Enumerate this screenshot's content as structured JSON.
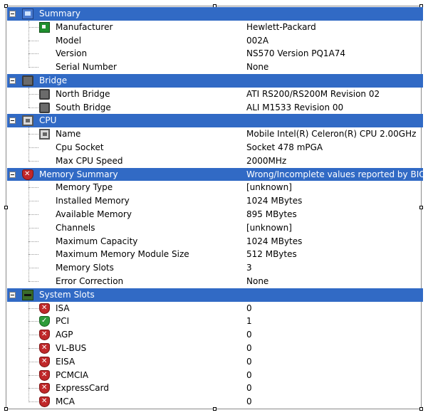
{
  "sections": [
    {
      "label": "Summary",
      "icon": "computer-icon",
      "value": "",
      "items": [
        {
          "label": "Manufacturer",
          "value": "Hewlett-Packard",
          "icon": "board-icon"
        },
        {
          "label": "Model",
          "value": "002A",
          "icon": ""
        },
        {
          "label": "Version",
          "value": "NS570 Version PQ1A74",
          "icon": ""
        },
        {
          "label": "Serial Number",
          "value": "None",
          "icon": ""
        }
      ]
    },
    {
      "label": "Bridge",
      "icon": "chip-icon",
      "value": "",
      "items": [
        {
          "label": "North Bridge",
          "value": "ATI RS200/RS200M Revision 02",
          "icon": "chip-icon"
        },
        {
          "label": "South Bridge",
          "value": "ALI M1533 Revision 00",
          "icon": "chip-icon"
        }
      ]
    },
    {
      "label": "CPU",
      "icon": "cpu-icon",
      "value": "",
      "items": [
        {
          "label": "Name",
          "value": "Mobile Intel(R) Celeron(R) CPU 2.00GHz",
          "icon": "cpu-icon"
        },
        {
          "label": "Cpu Socket",
          "value": "Socket 478 mPGA",
          "icon": ""
        },
        {
          "label": "Max CPU Speed",
          "value": "2000MHz",
          "icon": ""
        }
      ]
    },
    {
      "label": "Memory Summary",
      "icon": "warning-shield-icon",
      "value": "Wrong/Incomplete values reported by BIOS",
      "items": [
        {
          "label": "Memory Type",
          "value": "[unknown]",
          "icon": ""
        },
        {
          "label": "Installed Memory",
          "value": "1024 MBytes",
          "icon": ""
        },
        {
          "label": "Available Memory",
          "value": "895 MBytes",
          "icon": ""
        },
        {
          "label": "Channels",
          "value": "[unknown]",
          "icon": ""
        },
        {
          "label": "Maximum Capacity",
          "value": "1024 MBytes",
          "icon": ""
        },
        {
          "label": "Maximum Memory Module Size",
          "value": "512 MBytes",
          "icon": ""
        },
        {
          "label": "Memory Slots",
          "value": "3",
          "icon": ""
        },
        {
          "label": "Error Correction",
          "value": "None",
          "icon": ""
        }
      ]
    },
    {
      "label": "System Slots",
      "icon": "slots-icon",
      "value": "",
      "items": [
        {
          "label": "ISA",
          "value": "0",
          "icon": "x-shield-icon"
        },
        {
          "label": "PCI",
          "value": "1",
          "icon": "check-shield-icon"
        },
        {
          "label": "AGP",
          "value": "0",
          "icon": "x-shield-icon"
        },
        {
          "label": "VL-BUS",
          "value": "0",
          "icon": "x-shield-icon"
        },
        {
          "label": "EISA",
          "value": "0",
          "icon": "x-shield-icon"
        },
        {
          "label": "PCMCIA",
          "value": "0",
          "icon": "x-shield-icon"
        },
        {
          "label": "ExpressCard",
          "value": "0",
          "icon": "x-shield-icon"
        },
        {
          "label": "MCA",
          "value": "0",
          "icon": "x-shield-icon"
        }
      ]
    }
  ],
  "colors": {
    "section_bg": "#316ac5",
    "section_text": "#ffffff"
  }
}
